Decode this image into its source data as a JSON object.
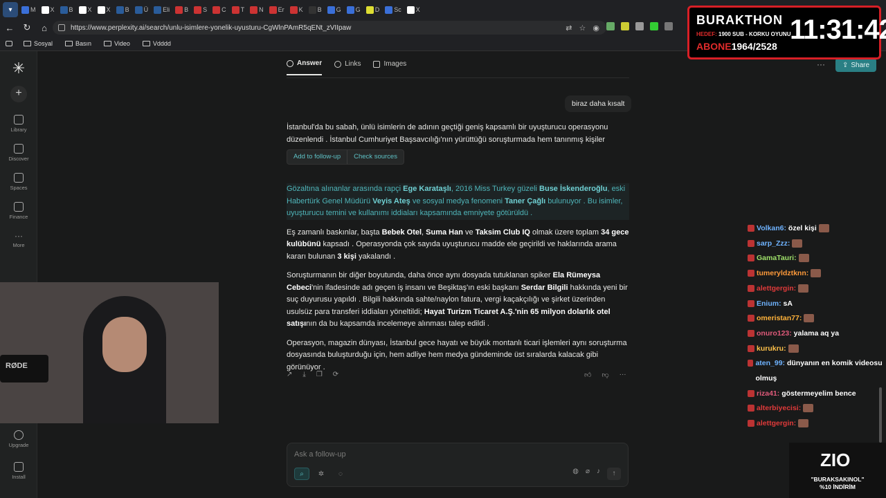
{
  "browser": {
    "url": "https://www.perplexity.ai/search/unlu-isimlere-yonelik-uyusturu-CgWlnPAmR5qENt_zVIIpaw",
    "tabs": [
      "M",
      "X",
      "B",
      "X",
      "X",
      "B",
      "Ü",
      "Eli",
      "B",
      "S",
      "C",
      "T",
      "N",
      "Er",
      "K",
      "B",
      "G",
      "G",
      "D",
      "Sc",
      "X"
    ],
    "bookmarks": [
      "Sosyal",
      "Basın",
      "Video",
      "Vdddd"
    ]
  },
  "sidebar": {
    "items": [
      {
        "label": "Library",
        "icon": "library-icon"
      },
      {
        "label": "Discover",
        "icon": "discover-icon"
      },
      {
        "label": "Spaces",
        "icon": "spaces-icon"
      },
      {
        "label": "Finance",
        "icon": "finance-icon"
      },
      {
        "label": "More",
        "icon": "more-icon"
      },
      {
        "label": "Upgrade",
        "icon": "upgrade-icon"
      },
      {
        "label": "Install",
        "icon": "install-icon"
      }
    ]
  },
  "header": {
    "tabs": [
      {
        "label": "Answer"
      },
      {
        "label": "Links"
      },
      {
        "label": "Images"
      }
    ],
    "share_label": "Share"
  },
  "query": "biraz daha kısalt",
  "popup": {
    "follow_up": "Add to follow-up",
    "check_sources": "Check sources"
  },
  "answer": {
    "p1_line1": "İstanbul'da bu sabah, ünlü isimlerin de adının geçtiği geniş kapsamlı bir uyuşturucu operasyonu düzenlendi . İstanbul Cumhuriyet Başsavcılığı'nın yürüttüğü soruşturmada hem tanınmış kişiler",
    "p2": [
      {
        "t": "Gözaltına alınanlar arasında rapçi ",
        "b": false
      },
      {
        "t": "Ege Karataşlı",
        "b": true
      },
      {
        "t": ", 2016 Miss Turkey güzeli ",
        "b": false
      },
      {
        "t": "Buse İskenderoğlu",
        "b": true
      },
      {
        "t": ", eski Habertürk Genel Müdürü ",
        "b": false
      },
      {
        "t": "Veyis Ateş",
        "b": true
      },
      {
        "t": " ve sosyal medya fenomeni ",
        "b": false
      },
      {
        "t": "Taner Çağlı",
        "b": true
      },
      {
        "t": " bulunuyor . Bu isimler, uyuşturucu temini ve kullanımı iddiaları kapsamında emniyete götürüldü .",
        "b": false
      }
    ],
    "p3": [
      {
        "t": "Eş zamanlı baskınlar, başta ",
        "b": false
      },
      {
        "t": "Bebek Otel",
        "b": true
      },
      {
        "t": ", ",
        "b": false
      },
      {
        "t": "Suma Han",
        "b": true
      },
      {
        "t": " ve ",
        "b": false
      },
      {
        "t": "Taksim Club IQ",
        "b": true
      },
      {
        "t": " olmak üzere toplam ",
        "b": false
      },
      {
        "t": "34 gece kulübünü",
        "b": true
      },
      {
        "t": " kapsadı . Operasyonda çok sayıda uyuşturucu madde ele geçirildi ve haklarında arama kararı bulunan ",
        "b": false
      },
      {
        "t": "3 kişi",
        "b": true
      },
      {
        "t": " yakalandı .",
        "b": false
      }
    ],
    "p4": [
      {
        "t": "Soruşturmanın bir diğer boyutunda, daha önce aynı dosyada tutuklanan spiker ",
        "b": false
      },
      {
        "t": "Ela Rümeysa Cebeci",
        "b": true
      },
      {
        "t": "'nin ifadesinde adı geçen iş insanı ve Beşiktaş'ın eski başkanı ",
        "b": false
      },
      {
        "t": "Serdar Bilgili",
        "b": true
      },
      {
        "t": " hakkında yeni bir suç duyurusu yapıldı . Bilgili hakkında sahte/naylon fatura, vergi kaçakçılığı ve şirket üzerinden usulsüz para transferi iddiaları yöneltildi; ",
        "b": false
      },
      {
        "t": "Hayat Turizm Ticaret A.Ş.'nin 65 milyon dolarlık otel satışı",
        "b": true
      },
      {
        "t": "nın da bu kapsamda incelemeye alınması talep edildi .",
        "b": false
      }
    ],
    "p5": "Operasyon, magazin dünyası, İstanbul gece hayatı ve büyük montanlı ticari işlemleri aynı soruşturma dosyasında buluşturduğu için, hem adliye hem medya gündeminde üst sıralarda kalacak gibi görünüyor ."
  },
  "ask": {
    "placeholder": "Ask a follow-up"
  },
  "chat": [
    {
      "user": "Volkan6:",
      "text": "özel kişi",
      "color": "#6fb3ff",
      "emote": true
    },
    {
      "user": "sarp_Zzz:",
      "text": "",
      "color": "#6fb3ff",
      "emote": true
    },
    {
      "user": "GamaTauri:",
      "text": "",
      "color": "#9fe06a",
      "emote": true
    },
    {
      "user": "tumeryldztknn:",
      "text": "",
      "color": "#ff9a3a",
      "emote": true
    },
    {
      "user": "alettgergin:",
      "text": "",
      "color": "#e03a3a",
      "emote": true
    },
    {
      "user": "Enium:",
      "text": "sA",
      "color": "#6fb3ff",
      "emote": false
    },
    {
      "user": "omeristan77:",
      "text": "",
      "color": "#ffb23a",
      "emote": true
    },
    {
      "user": "onuro123:",
      "text": "yalama aq ya",
      "color": "#e05a7a",
      "emote": false
    },
    {
      "user": "kurukru:",
      "text": "",
      "color": "#ffc14a",
      "emote": true
    },
    {
      "user": "aten_99:",
      "text": "dünyanın en komik videosu olmuş",
      "color": "#6fb3ff",
      "emote": false
    },
    {
      "user": "riza41:",
      "text": "göstermeyelim bence",
      "color": "#e05a7a",
      "emote": false
    },
    {
      "user": "alterbiyecisi:",
      "text": "",
      "color": "#e03a3a",
      "emote": true
    },
    {
      "user": "alettgergin:",
      "text": "",
      "color": "#e03a3a",
      "emote": true
    }
  ],
  "overlay": {
    "name": "BURAKTHON",
    "hedef_label": "HEDEF:",
    "hedef_value": "1900 SUB - KORKU OYUNU",
    "abone_label": "ABONE",
    "abone_value": "1964/2528",
    "clock": "11:31:42"
  },
  "promo": {
    "brand": "ZIO",
    "code": "\"BURAKSAKINOL\"",
    "discount": "%10 İNDİRİM"
  },
  "webcam": {
    "mic_brand": "RØDE"
  }
}
